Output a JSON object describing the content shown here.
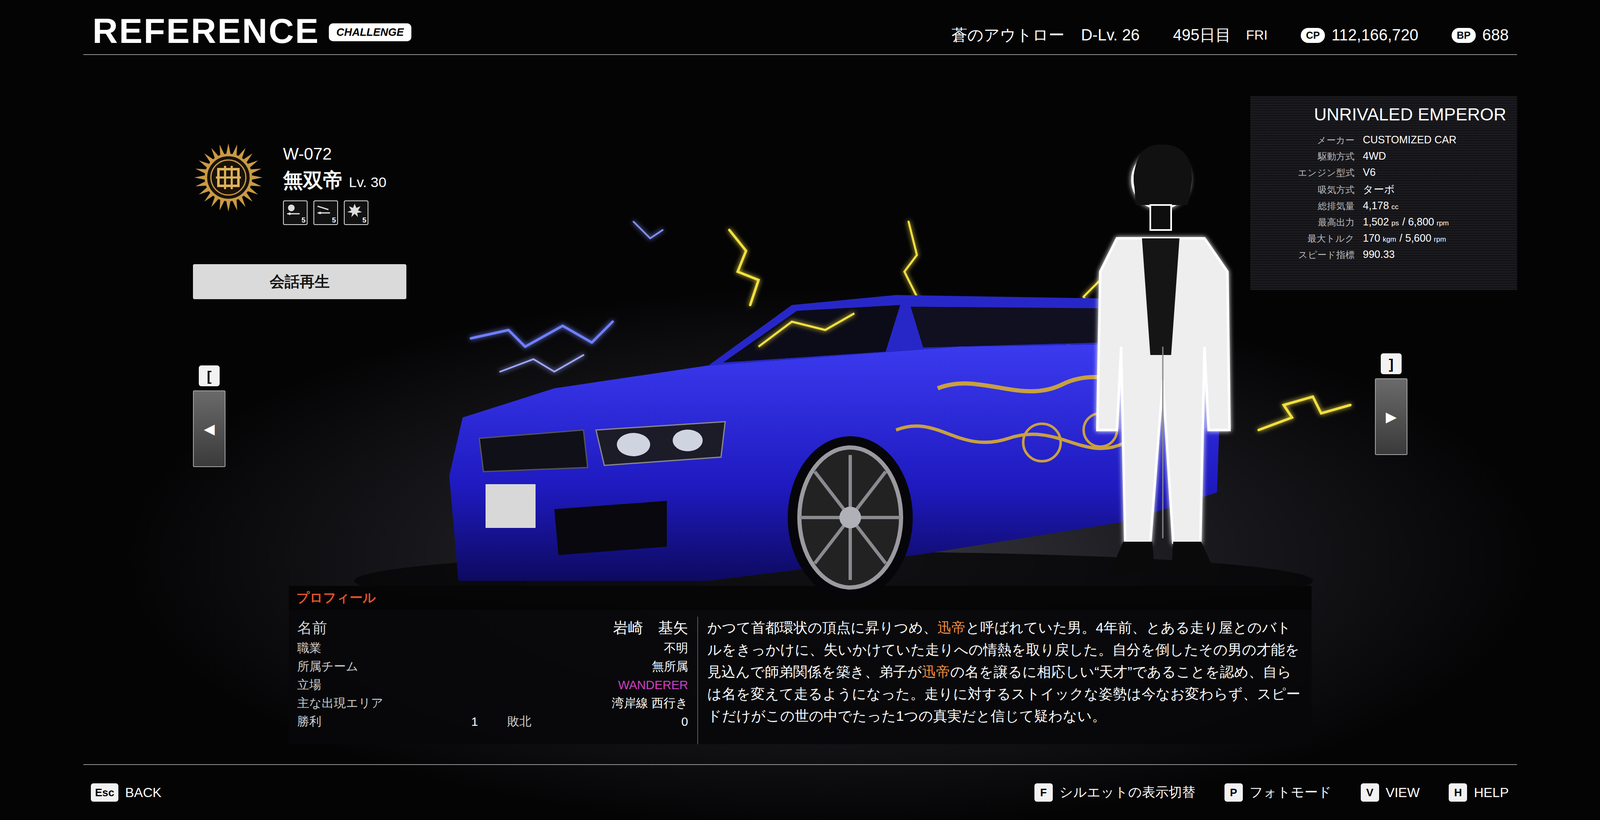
{
  "header": {
    "title": "REFERENCE",
    "badge": "CHALLENGE",
    "player": "蒼のアウトロー",
    "level": "D-Lv. 26",
    "day": "495日目",
    "weekday": "FRI",
    "cp_label": "CP",
    "cp": "112,166,720",
    "bp_label": "BP",
    "bp": "688"
  },
  "rival": {
    "id": "W-072",
    "name": "無双帝",
    "level": "Lv. 30",
    "skills": [
      {
        "kind": "gauge",
        "value": "5"
      },
      {
        "kind": "key",
        "value": "5"
      },
      {
        "kind": "burst",
        "value": "5"
      }
    ]
  },
  "talk_button": "会話再生",
  "nav": {
    "prev_key": "[",
    "prev_arrow": "◀",
    "next_key": "]",
    "next_arrow": "▶"
  },
  "car": {
    "title": "UNRIVALED EMPEROR",
    "specs": [
      {
        "label": "メーカー",
        "parts": [
          {
            "text": "CUSTOMIZED CAR",
            "kind": "num"
          }
        ]
      },
      {
        "label": "駆動方式",
        "parts": [
          {
            "text": "4WD",
            "kind": "num"
          }
        ]
      },
      {
        "label": "エンジン型式",
        "parts": [
          {
            "text": "V6",
            "kind": "num"
          }
        ]
      },
      {
        "label": "吸気方式",
        "parts": [
          {
            "text": "ターボ",
            "kind": "num"
          }
        ]
      },
      {
        "label": "総排気量",
        "parts": [
          {
            "text": "4,178",
            "kind": "num"
          },
          {
            "text": "cc",
            "kind": "unit"
          }
        ]
      },
      {
        "label": "最高出力",
        "parts": [
          {
            "text": "1,502",
            "kind": "num"
          },
          {
            "text": "ps",
            "kind": "unit"
          },
          {
            "text": "/ 6,800",
            "kind": "num"
          },
          {
            "text": "rpm",
            "kind": "unit"
          }
        ]
      },
      {
        "label": "最大トルク",
        "parts": [
          {
            "text": "170",
            "kind": "num"
          },
          {
            "text": "kgm",
            "kind": "unit"
          },
          {
            "text": "/ 5,600",
            "kind": "num"
          },
          {
            "text": "rpm",
            "kind": "unit"
          }
        ]
      },
      {
        "label": "スピード指標",
        "parts": [
          {
            "text": "990.33",
            "kind": "num"
          }
        ]
      }
    ]
  },
  "profile": {
    "header": "プロフィール",
    "name_label": "名前",
    "name": "岩崎　基矢",
    "fields": [
      {
        "label": "職業",
        "value": "不明",
        "color": "#ffffff"
      },
      {
        "label": "所属チーム",
        "value": "無所属",
        "color": "#ffffff"
      },
      {
        "label": "立場",
        "value": "WANDERER",
        "color": "#d23fc4"
      },
      {
        "label": "主な出現エリア",
        "value": "湾岸線 西行き",
        "color": "#ffffff"
      }
    ],
    "win_label": "勝利",
    "wins": "1",
    "loss_label": "敗北",
    "losses": "0",
    "description": [
      {
        "text": "かつて首都環状の頂点に昇りつめ、",
        "highlight": false
      },
      {
        "text": "迅帝",
        "highlight": true
      },
      {
        "text": "と呼ばれていた男。4年前、とある走り屋とのバトルをきっかけに、失いかけていた走りへの情熱を取り戻した。自分を倒したその男の才能を見込んで師弟関係を築き、弟子が",
        "highlight": false
      },
      {
        "text": "迅帝",
        "highlight": true
      },
      {
        "text": "の名を譲るに相応しい“天才”であることを認め、自らは名を変えて走るようになった。走りに対するストイックな姿勢は今なお変わらず、スピードだけがこの世の中でたった1つの真実だと信じて疑わない。",
        "highlight": false
      }
    ]
  },
  "footer": {
    "left": [
      {
        "key": "Esc",
        "label": "BACK"
      }
    ],
    "right": [
      {
        "key": "F",
        "label": "シルエットの表示切替"
      },
      {
        "key": "P",
        "label": "フォトモード"
      },
      {
        "key": "V",
        "label": "VIEW"
      },
      {
        "key": "H",
        "label": "HELP"
      }
    ]
  }
}
